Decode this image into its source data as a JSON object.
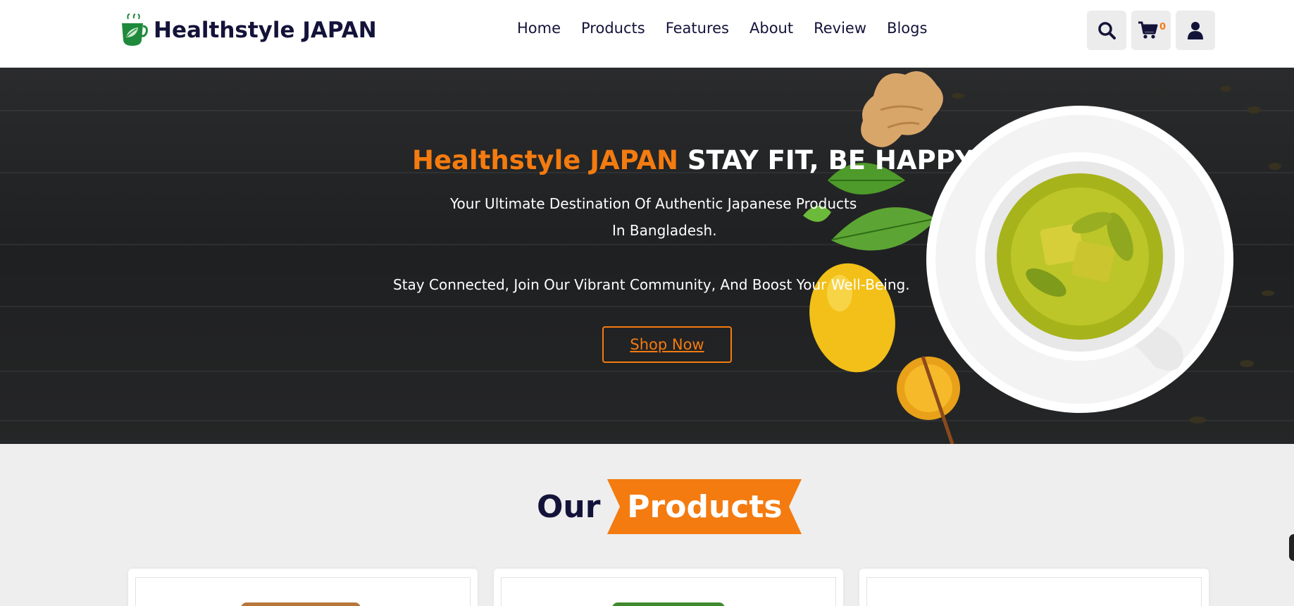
{
  "header": {
    "brand": "Healthstyle JAPAN",
    "nav": [
      "Home",
      "Products",
      "Features",
      "About",
      "Review",
      "Blogs"
    ],
    "cart_count": "0",
    "icons": [
      "search-icon",
      "cart-icon",
      "user-icon"
    ]
  },
  "hero": {
    "title_brand": "Healthstyle JAPAN",
    "title_tagline": "STAY FIT, BE HAPPY",
    "line1": "Your Ultimate Destination Of Authentic Japanese Products",
    "line2": "In Bangladesh.",
    "line3": "Stay Connected, Join Our Vibrant Community, And Boost Your Well-Being.",
    "cta": "Shop Now"
  },
  "products_section": {
    "title_our": "Our",
    "title_products": "Products"
  },
  "colors": {
    "accent": "#f47b10",
    "navy": "#13133a",
    "logo_green": "#1f8a3b"
  }
}
